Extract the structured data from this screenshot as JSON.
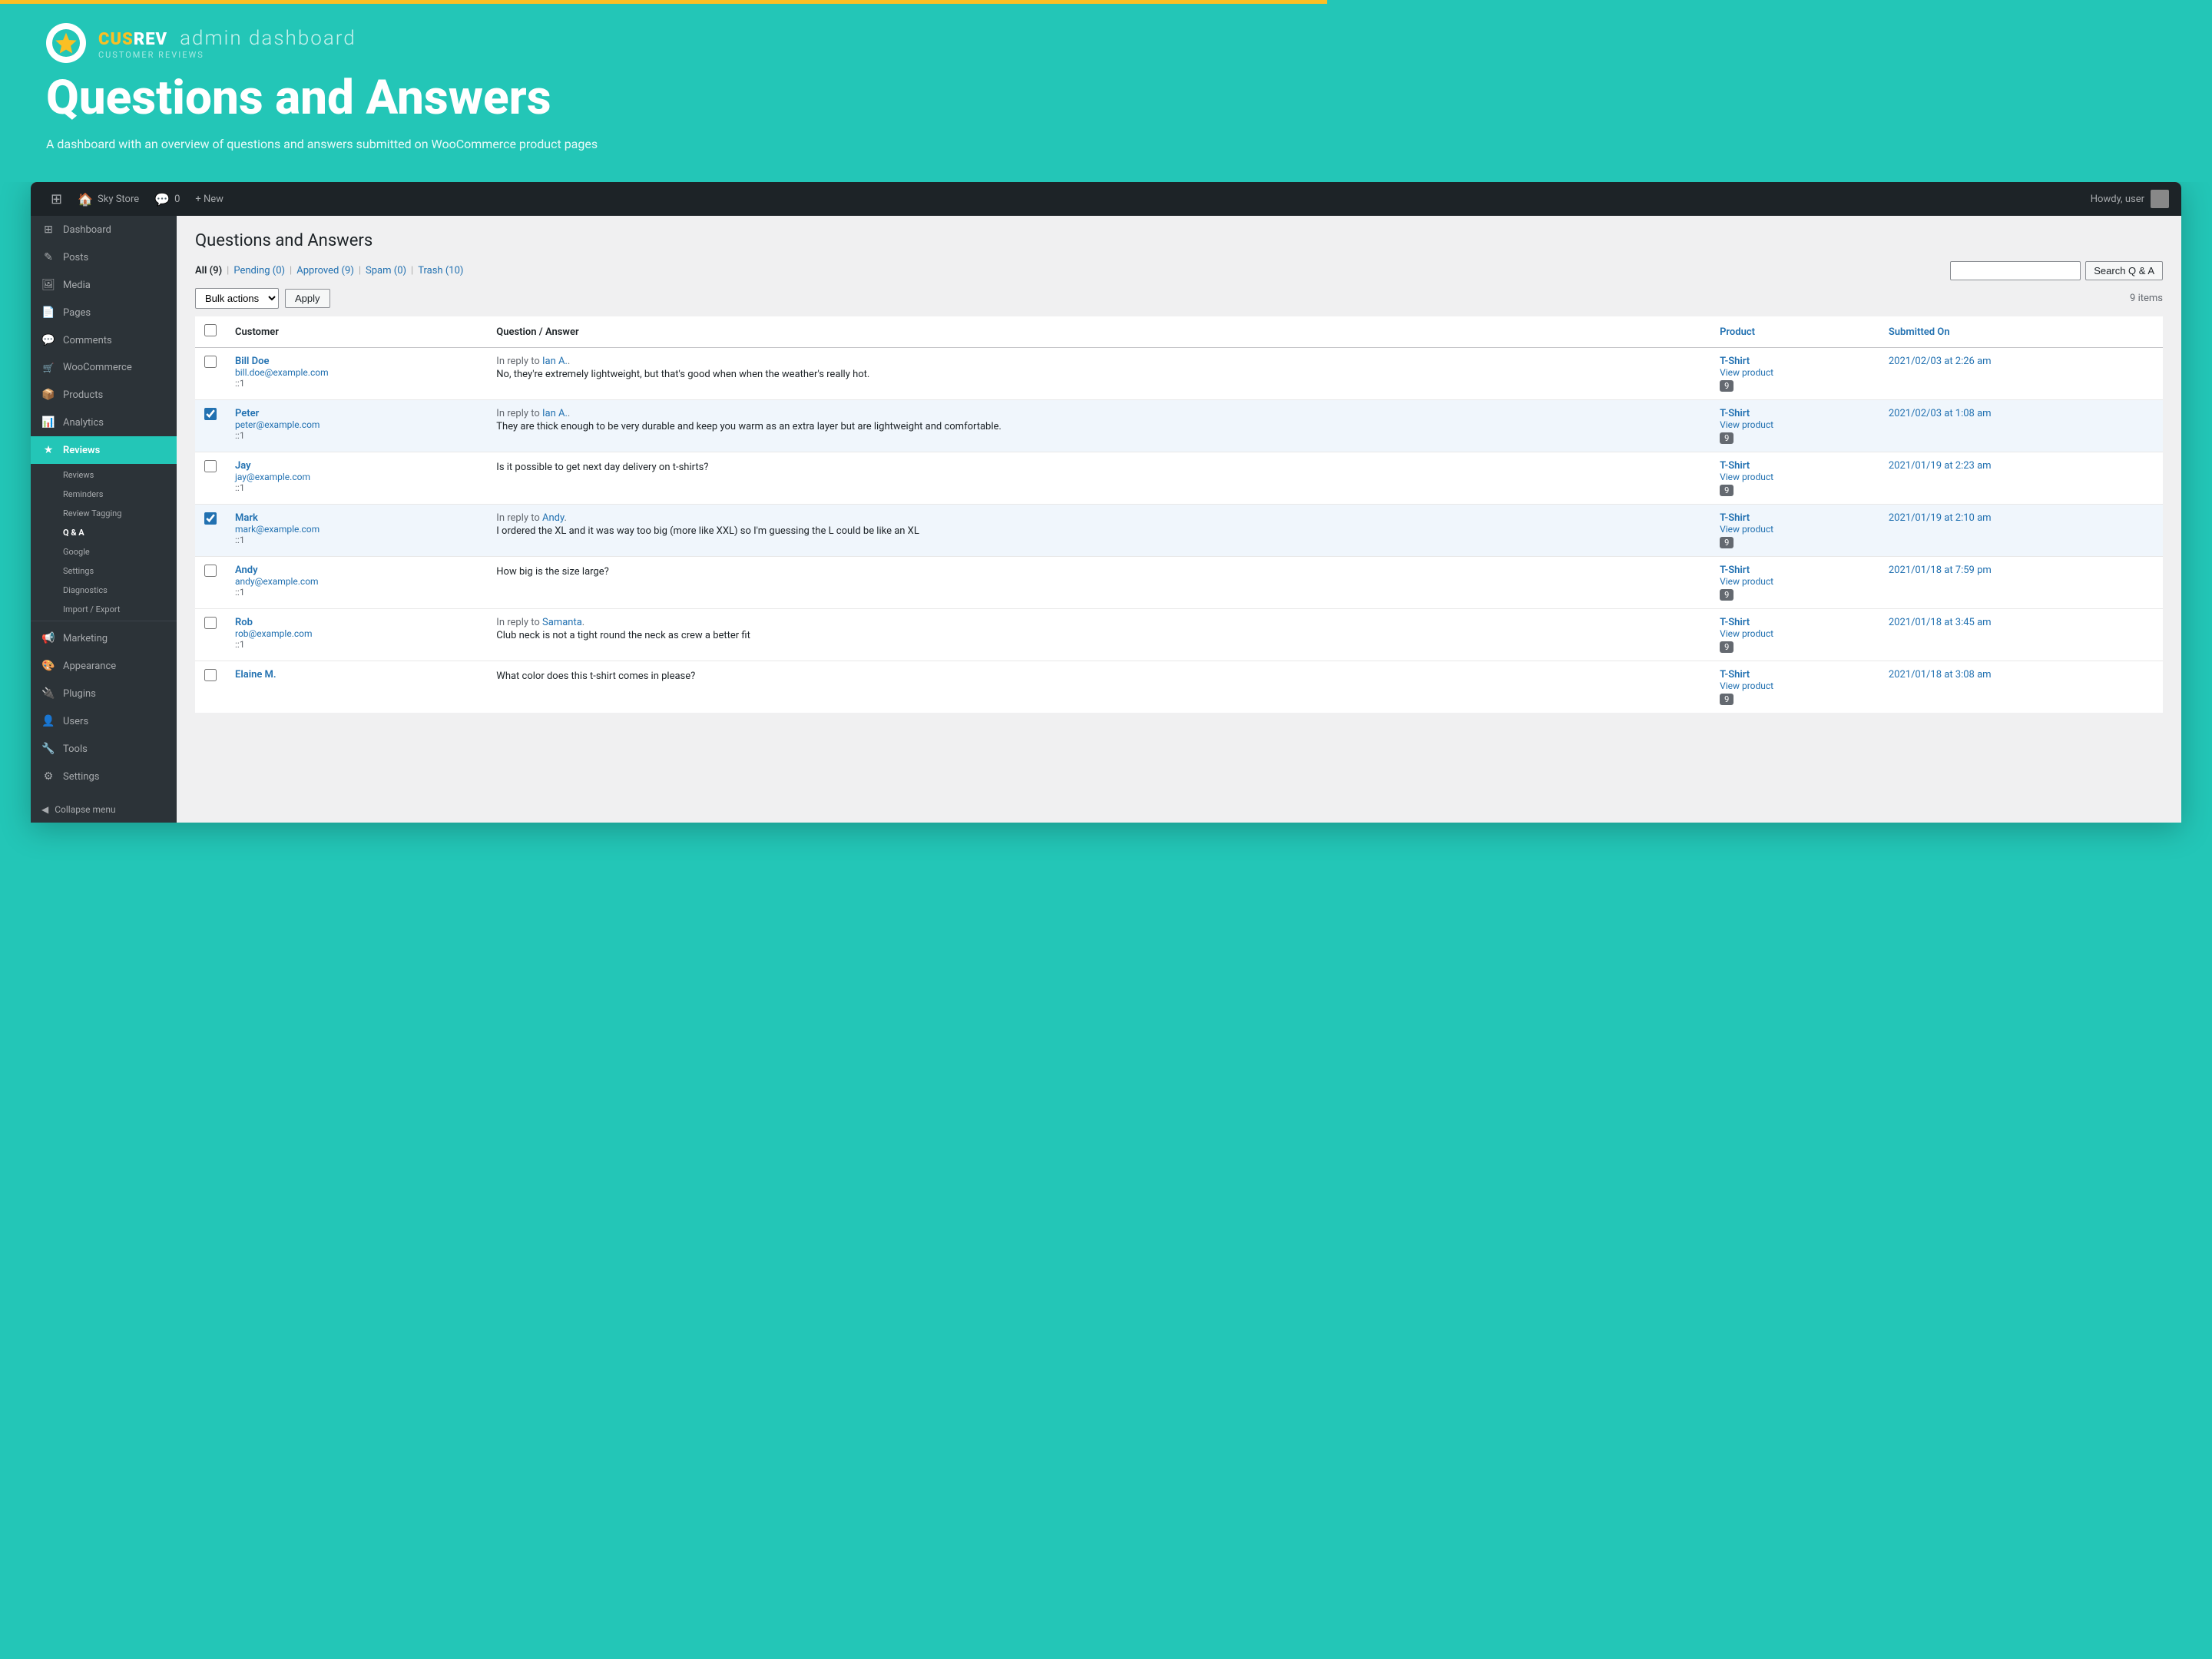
{
  "header": {
    "brand": "CUSREV",
    "brand_sub": "CUSTOMER REVIEWS",
    "admin_label": "admin dashboard",
    "page_title": "Questions and Answers",
    "description": "A dashboard with an overview of questions and answers submitted on WooCommerce product pages"
  },
  "wp_bar": {
    "wp_icon": "⊞",
    "store_name": "Sky Store",
    "comments_icon": "💬",
    "comments_count": "0",
    "new_label": "+ New",
    "howdy": "Howdy, user"
  },
  "sidebar": {
    "items": [
      {
        "id": "dashboard",
        "icon": "⊞",
        "label": "Dashboard"
      },
      {
        "id": "posts",
        "icon": "✎",
        "label": "Posts"
      },
      {
        "id": "media",
        "icon": "🖼",
        "label": "Media"
      },
      {
        "id": "pages",
        "icon": "📄",
        "label": "Pages"
      },
      {
        "id": "comments",
        "icon": "💬",
        "label": "Comments"
      },
      {
        "id": "woocommerce",
        "icon": "🛒",
        "label": "WooCommerce"
      },
      {
        "id": "products",
        "icon": "📦",
        "label": "Products"
      },
      {
        "id": "analytics",
        "icon": "📊",
        "label": "Analytics"
      },
      {
        "id": "reviews",
        "icon": "★",
        "label": "Reviews",
        "active": true
      },
      {
        "id": "marketing",
        "icon": "📢",
        "label": "Marketing"
      },
      {
        "id": "appearance",
        "icon": "🎨",
        "label": "Appearance"
      },
      {
        "id": "plugins",
        "icon": "🔌",
        "label": "Plugins"
      },
      {
        "id": "users",
        "icon": "👤",
        "label": "Users"
      },
      {
        "id": "tools",
        "icon": "🔧",
        "label": "Tools"
      },
      {
        "id": "settings",
        "icon": "⚙",
        "label": "Settings"
      }
    ],
    "sub_items": [
      {
        "id": "reviews-sub",
        "label": "Reviews"
      },
      {
        "id": "reminders",
        "label": "Reminders"
      },
      {
        "id": "review-tagging",
        "label": "Review Tagging"
      },
      {
        "id": "qa",
        "label": "Q & A",
        "bold": true
      },
      {
        "id": "google",
        "label": "Google"
      },
      {
        "id": "settings-sub",
        "label": "Settings"
      },
      {
        "id": "diagnostics",
        "label": "Diagnostics"
      },
      {
        "id": "import-export",
        "label": "Import / Export"
      }
    ],
    "collapse_label": "Collapse menu"
  },
  "content": {
    "title": "Questions and Answers",
    "filter": {
      "all_label": "All",
      "all_count": "9",
      "pending_label": "Pending",
      "pending_count": "0",
      "approved_label": "Approved",
      "approved_count": "9",
      "spam_label": "Spam",
      "spam_count": "0",
      "trash_label": "Trash",
      "trash_count": "10"
    },
    "search_placeholder": "",
    "search_btn": "Search Q & A",
    "bulk_actions_default": "Bulk actions",
    "apply_btn": "Apply",
    "items_count": "9 items",
    "table_headers": {
      "customer": "Customer",
      "qa": "Question / Answer",
      "product": "Product",
      "submitted": "Submitted On"
    },
    "rows": [
      {
        "id": "row1",
        "checked": false,
        "customer_name": "Bill Doe",
        "customer_email": "bill.doe@example.com",
        "customer_id": "::1",
        "reply_to": "Ian A.",
        "reply_to_link": true,
        "answer_text": "No, they're extremely lightweight, but that's good when when the weather's really hot.",
        "product_name": "T-Shirt",
        "product_badge": "9",
        "submitted": "2021/02/03 at 2:26 am"
      },
      {
        "id": "row2",
        "checked": true,
        "customer_name": "Peter",
        "customer_email": "peter@example.com",
        "customer_id": "::1",
        "reply_to": "Ian A.",
        "reply_to_link": true,
        "answer_text": "They are thick enough to be very durable and keep you warm as an extra layer but are lightweight and comfortable.",
        "product_name": "T-Shirt",
        "product_badge": "9",
        "submitted": "2021/02/03 at 1:08 am"
      },
      {
        "id": "row3",
        "checked": false,
        "customer_name": "Jay",
        "customer_email": "jay@example.com",
        "customer_id": "::1",
        "reply_to": null,
        "answer_text": "Is it possible to get next day delivery on t-shirts?",
        "product_name": "T-Shirt",
        "product_badge": "9",
        "submitted": "2021/01/19 at 2:23 am"
      },
      {
        "id": "row4",
        "checked": true,
        "customer_name": "Mark",
        "customer_email": "mark@example.com",
        "customer_id": "::1",
        "reply_to": "Andy",
        "reply_to_link": true,
        "answer_text": "I ordered the XL and it was way too big (more like XXL) so I'm guessing the L could be like an XL",
        "product_name": "T-Shirt",
        "product_badge": "9",
        "submitted": "2021/01/19 at 2:10 am"
      },
      {
        "id": "row5",
        "checked": false,
        "customer_name": "Andy",
        "customer_email": "andy@example.com",
        "customer_id": "::1",
        "reply_to": null,
        "answer_text": "How big is the size large?",
        "product_name": "T-Shirt",
        "product_badge": "9",
        "submitted": "2021/01/18 at 7:59 pm"
      },
      {
        "id": "row6",
        "checked": false,
        "customer_name": "Rob",
        "customer_email": "rob@example.com",
        "customer_id": "::1",
        "reply_to": "Samanta",
        "reply_to_link": true,
        "answer_text": "Club neck is not a tight round the neck as crew a better fit",
        "product_name": "T-Shirt",
        "product_badge": "9",
        "submitted": "2021/01/18 at 3:45 am"
      },
      {
        "id": "row7",
        "checked": false,
        "customer_name": "Elaine M.",
        "customer_email": "",
        "customer_id": "",
        "reply_to": null,
        "answer_text": "What color does this t-shirt comes in please?",
        "product_name": "T-Shirt",
        "product_badge": "9",
        "submitted": "2021/01/18 at 3:08 am"
      }
    ],
    "view_product_label": "View product"
  }
}
